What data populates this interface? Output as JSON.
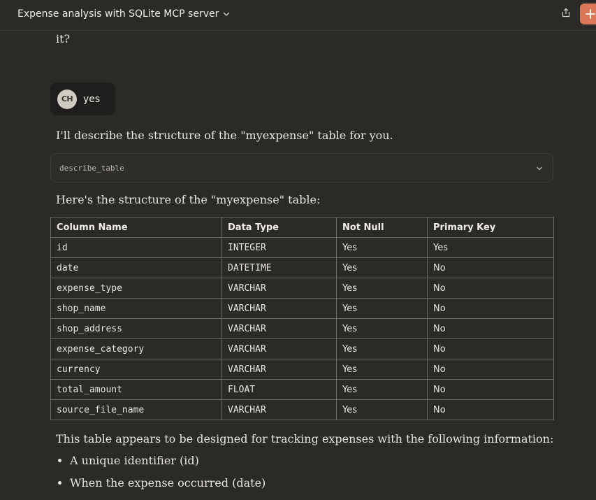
{
  "header": {
    "title": "Expense analysis with SQLite MCP server",
    "accent_color": "#d97757"
  },
  "conversation": {
    "previous_tail": "it?",
    "user_message": {
      "initials": "CH",
      "text": "yes"
    },
    "assistant": {
      "intro": "I'll describe the structure of the \"myexpense\" table for you.",
      "tool_call": "describe_table",
      "structure_heading": "Here's the structure of the \"myexpense\" table:",
      "table": {
        "headers": [
          "Column Name",
          "Data Type",
          "Not Null",
          "Primary Key"
        ],
        "rows": [
          [
            "id",
            "INTEGER",
            "Yes",
            "Yes"
          ],
          [
            "date",
            "DATETIME",
            "Yes",
            "No"
          ],
          [
            "expense_type",
            "VARCHAR",
            "Yes",
            "No"
          ],
          [
            "shop_name",
            "VARCHAR",
            "Yes",
            "No"
          ],
          [
            "shop_address",
            "VARCHAR",
            "Yes",
            "No"
          ],
          [
            "expense_category",
            "VARCHAR",
            "Yes",
            "No"
          ],
          [
            "currency",
            "VARCHAR",
            "Yes",
            "No"
          ],
          [
            "total_amount",
            "FLOAT",
            "Yes",
            "No"
          ],
          [
            "source_file_name",
            "VARCHAR",
            "Yes",
            "No"
          ]
        ]
      },
      "summary": "This table appears to be designed for tracking expenses with the following information:",
      "bullets": [
        "A unique identifier (id)",
        "When the expense occurred (date)"
      ]
    }
  }
}
